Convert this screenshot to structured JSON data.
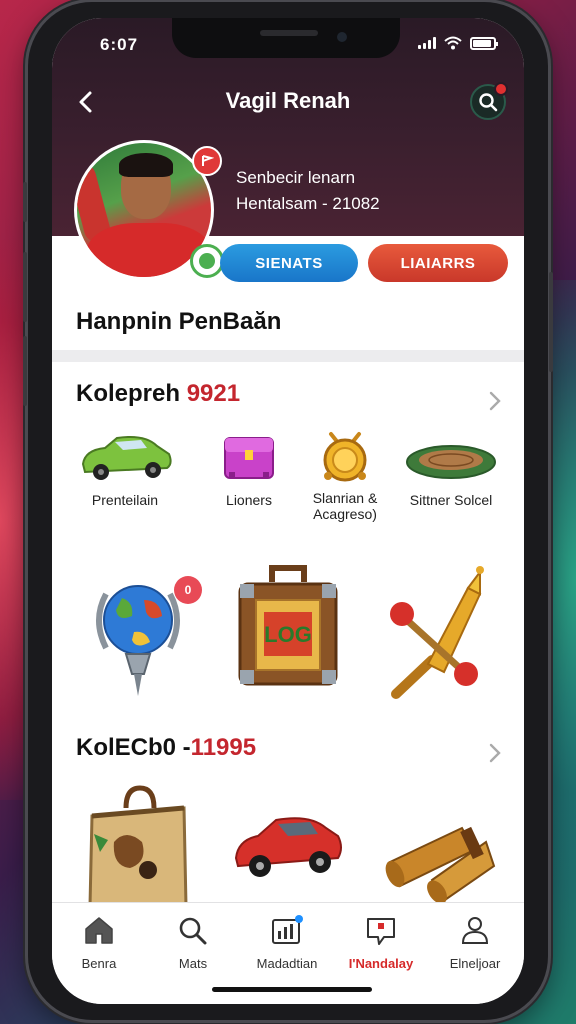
{
  "status_bar": {
    "time": "6:07"
  },
  "nav": {
    "title": "Vagil Renah"
  },
  "profile": {
    "line1": "Senbecir lenarn",
    "line2": "Hentalsam - 21082",
    "button_blue": "SIENATS",
    "button_red": "LIAIARRS"
  },
  "section_title": "Hanpnin PenBaăn",
  "collection1": {
    "title": "Kolepreh",
    "count": "9921",
    "items": [
      {
        "label": "Prenteilain",
        "icon": "green-car-icon"
      },
      {
        "label": "Lioners",
        "icon": "purple-chest-icon"
      },
      {
        "label": "Slanrian &\nAcagreso)",
        "icon": "gold-medal-icon"
      },
      {
        "label": "Sittner Solcel",
        "icon": "green-plate-icon"
      }
    ],
    "big_items": [
      {
        "icon": "globe-trophy-icon",
        "badge": "0"
      },
      {
        "icon": "suitcase-icon",
        "badge": ""
      },
      {
        "icon": "golden-rockets-icon",
        "badge": ""
      }
    ]
  },
  "collection2": {
    "title": "KolECb0 -",
    "count": "11995",
    "items": [
      {
        "icon": "travel-bag-icon"
      },
      {
        "icon": "red-car-icon"
      },
      {
        "icon": "scrolls-icon"
      }
    ]
  },
  "tabs": [
    {
      "label": "Benra",
      "icon": "home-icon",
      "active": false
    },
    {
      "label": "Mats",
      "icon": "search-icon",
      "active": false
    },
    {
      "label": "Madadtian",
      "icon": "chart-icon",
      "active": false
    },
    {
      "label": "I'Nandalay",
      "icon": "chat-icon",
      "active": true
    },
    {
      "label": "Elneljoar",
      "icon": "profile-icon",
      "active": false
    }
  ],
  "colors": {
    "accent_red": "#c4262e",
    "accent_blue": "#1976c9",
    "header_bg": "#2a1a26"
  }
}
